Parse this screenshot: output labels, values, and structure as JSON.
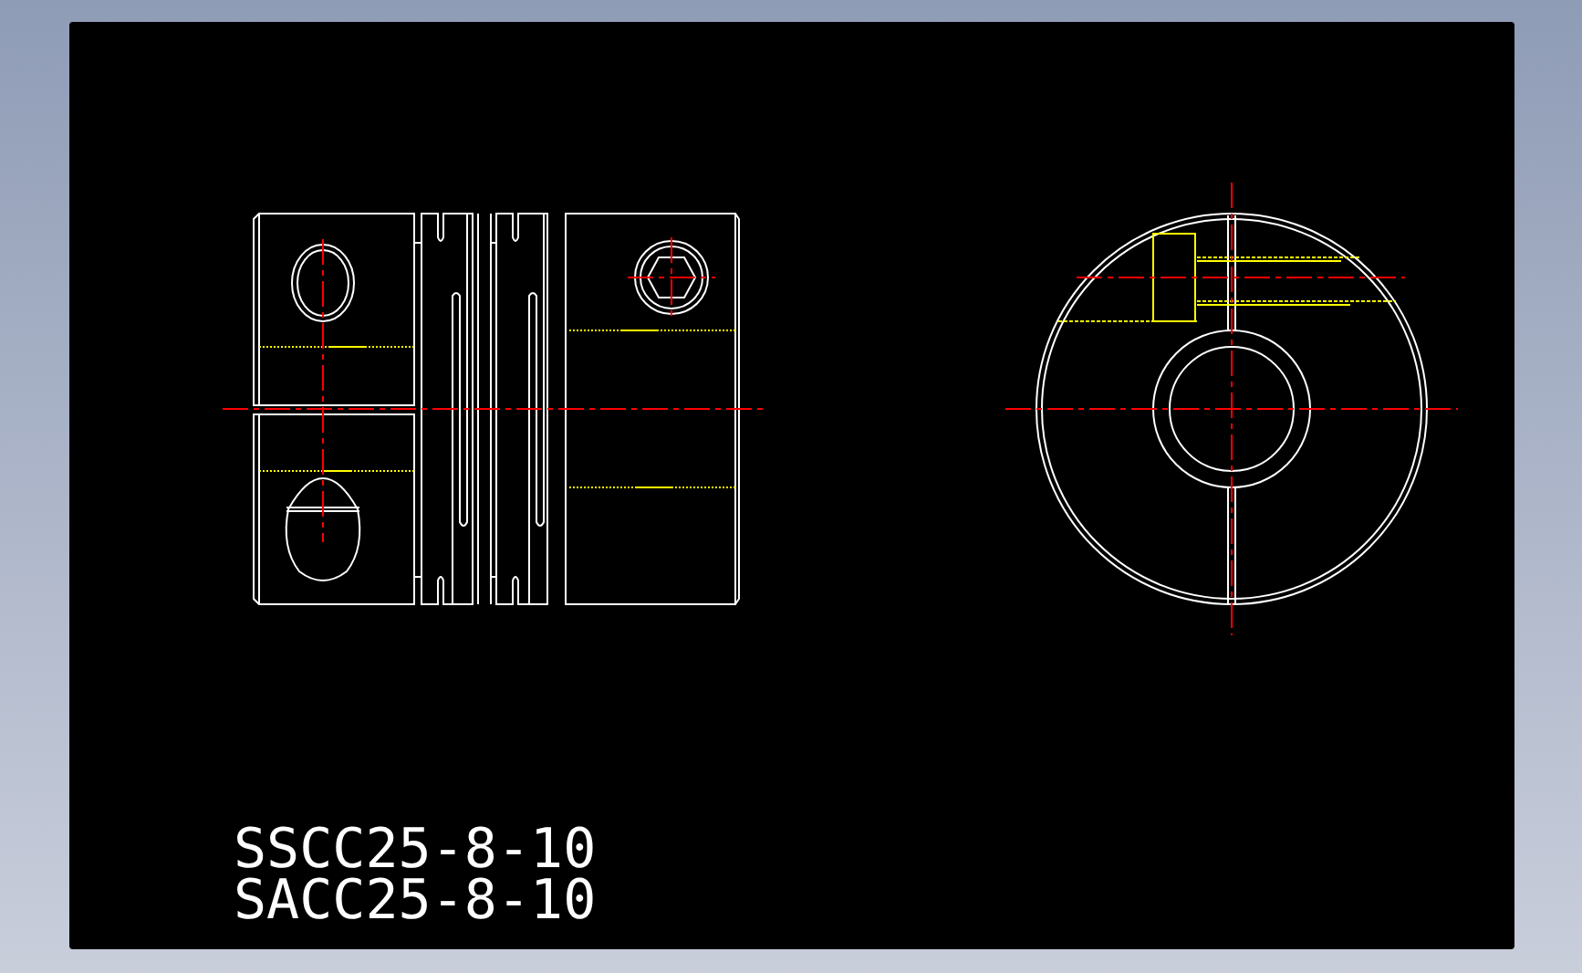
{
  "drawing_labels": [
    {
      "text": "SSCC25-8-10"
    },
    {
      "text": "SACC25-8-10"
    }
  ]
}
